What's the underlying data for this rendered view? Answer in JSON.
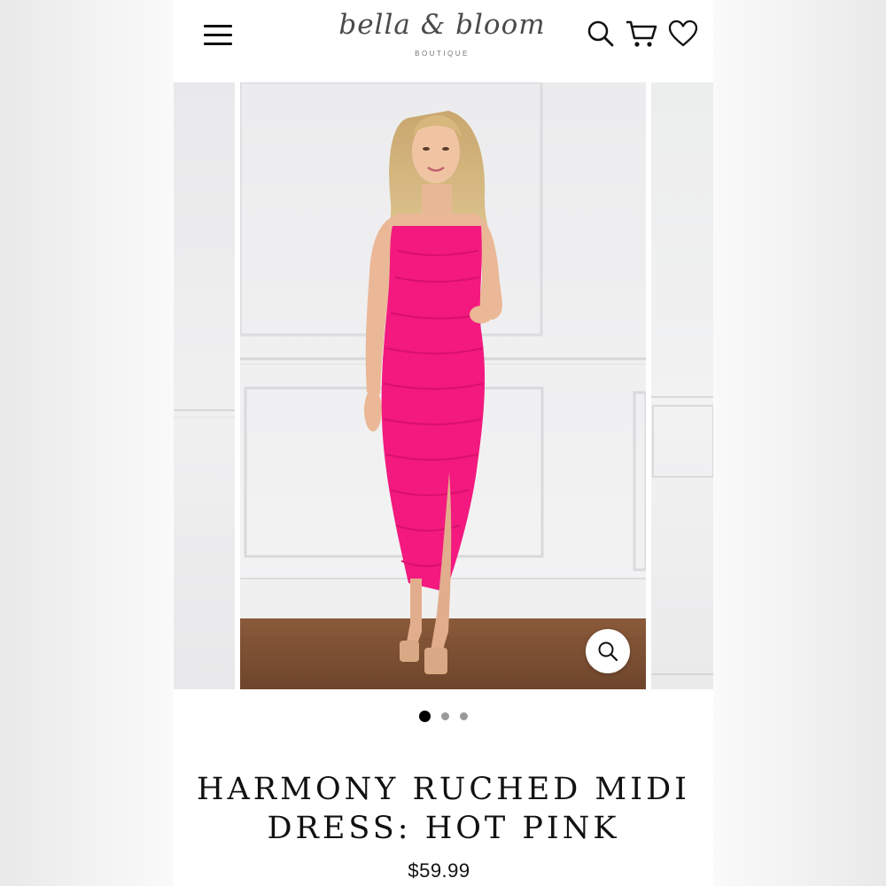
{
  "header": {
    "brand_script": "bella & bloom",
    "brand_sub": "BOUTIQUE",
    "icons": [
      "menu-icon",
      "search-icon",
      "cart-icon",
      "heart-icon"
    ]
  },
  "gallery": {
    "slide_count": 3,
    "active_index": 0,
    "zoom_icon": "zoom-icon",
    "dress_color": "#f3197f"
  },
  "product": {
    "title_line1": "HARMONY RUCHED MIDI",
    "title_line2": "DRESS: HOT PINK",
    "price": "$59.99"
  }
}
